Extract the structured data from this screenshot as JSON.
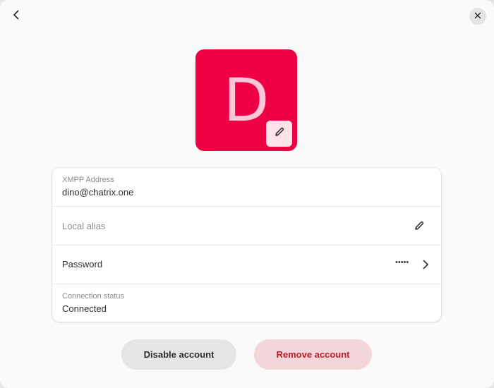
{
  "header": {
    "back_icon": "chevron-left-icon",
    "close_icon": "close-icon"
  },
  "avatar": {
    "letter": "D",
    "background_color": "#ef0044",
    "letter_color": "#fbc7d6",
    "edit_icon": "pencil-icon"
  },
  "account": {
    "xmpp_address_label": "XMPP Address",
    "xmpp_address_value": "dino@chatrix.one",
    "local_alias_label": "Local alias",
    "local_alias_edit_icon": "pencil-icon",
    "password_label": "Password",
    "password_mask": "•••••",
    "password_chevron_icon": "chevron-right-icon",
    "connection_status_label": "Connection status",
    "connection_status_value": "Connected"
  },
  "actions": {
    "disable_label": "Disable account",
    "remove_label": "Remove account"
  },
  "colors": {
    "destructive": "#c01c28",
    "destructive_bg": "#f2d6d9"
  }
}
